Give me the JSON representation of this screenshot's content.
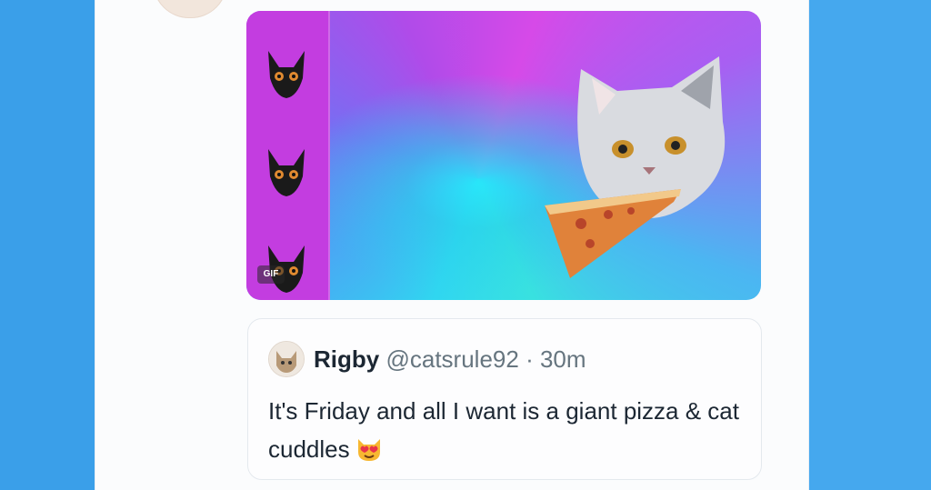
{
  "gif": {
    "badge": "GIF"
  },
  "quote": {
    "name": "Rigby",
    "handle": "@catsrule92",
    "separator": "·",
    "time": "30m",
    "text": "It's Friday and all I want is a giant pizza & cat cuddles",
    "emoji": "heart-eyes-cat-emoji"
  },
  "colors": {
    "page_blue": "#3aa0ea",
    "panel": "#fbfcfd",
    "text_primary": "#1c2733",
    "text_secondary": "#66757f",
    "strip_purple": "#c33de0"
  }
}
